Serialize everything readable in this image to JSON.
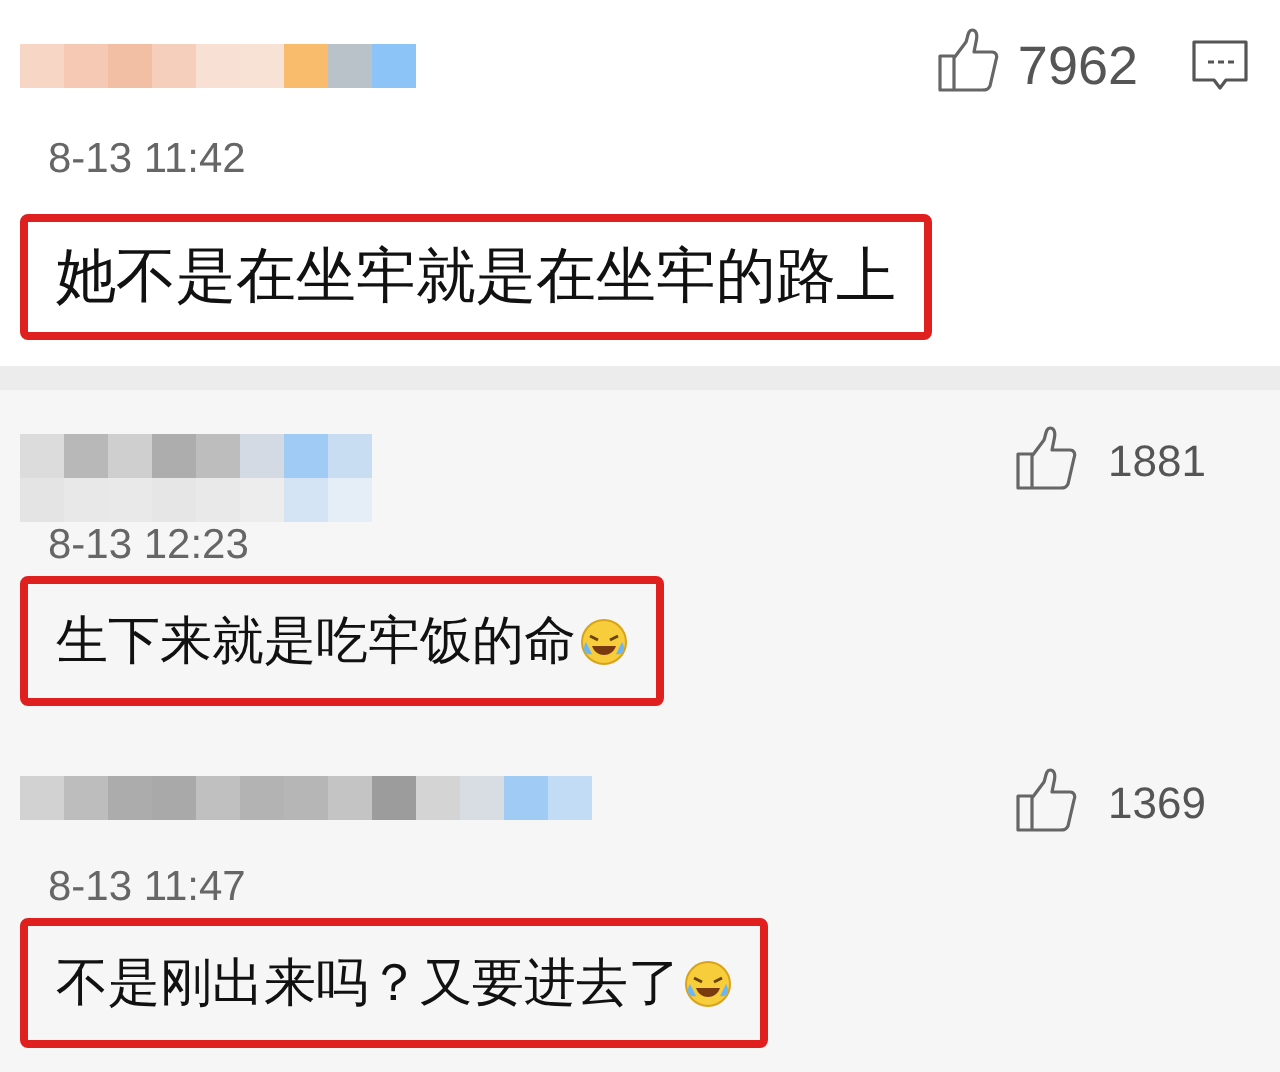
{
  "top_comment": {
    "likes": "7962",
    "time": "8-13 11:42",
    "text": "她不是在坐牢就是在坐牢的路上",
    "highlighted": true,
    "emoji": false,
    "reply_icon": true
  },
  "comments": [
    {
      "likes": "1881",
      "time": "8-13 12:23",
      "text": "生下来就是吃牢饭的命",
      "highlighted": true,
      "emoji": true,
      "reply_icon": false
    },
    {
      "likes": "1369",
      "time": "8-13 11:47",
      "text": "不是刚出来吗？又要进去了",
      "highlighted": true,
      "emoji": true,
      "reply_icon": false
    }
  ]
}
